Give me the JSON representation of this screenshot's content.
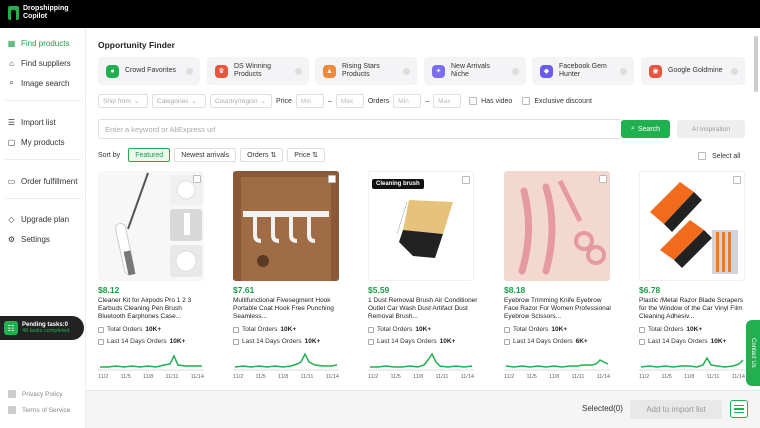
{
  "app": {
    "name": "Dropshipping Copilot"
  },
  "sidebar": {
    "items": [
      {
        "label": "Find products",
        "icon": "grid-icon"
      },
      {
        "label": "Find suppliers",
        "icon": "store-icon"
      },
      {
        "label": "Image search",
        "icon": "search-icon"
      },
      {
        "label": "Import list",
        "icon": "list-icon"
      },
      {
        "label": "My products",
        "icon": "box-icon"
      },
      {
        "label": "Order fulfillment",
        "icon": "truck-icon"
      },
      {
        "label": "Upgrade plan",
        "icon": "diamond-icon"
      },
      {
        "label": "Settings",
        "icon": "gear-icon"
      }
    ],
    "pending": {
      "title": "Pending tasks:0",
      "sub": "48 tasks completed"
    },
    "footer": [
      {
        "label": "Privacy Policy"
      },
      {
        "label": "Terms of Service"
      }
    ]
  },
  "main": {
    "title": "Opportunity Finder",
    "opportunities": [
      {
        "label": "Crowd Favorites",
        "color": "#21b04f"
      },
      {
        "label": "DS Winning Products",
        "color": "#e8553e"
      },
      {
        "label": "Rising Stars Products",
        "color": "#f08a3a"
      },
      {
        "label": "New Arrivals Niche",
        "color": "#7b6cf0"
      },
      {
        "label": "Facebook Gem Hunter",
        "color": "#6a5cf0"
      },
      {
        "label": "Google Goldmine",
        "color": "#e8553e"
      }
    ],
    "filters": {
      "ship_from": "Ship from",
      "categories": "Categories",
      "country": "Country/region",
      "price_label": "Price",
      "min": "Min",
      "max": "Max",
      "dash": "–",
      "orders_label": "Orders",
      "has_video": "Has video",
      "exclusive": "Exclusive discount"
    },
    "search": {
      "placeholder": "Enter a keyword or AliExpress url",
      "button": "Search",
      "ai": "AI Inspiration"
    },
    "sort": {
      "label": "Sort by",
      "options": [
        "Featured",
        "Newest arrivals",
        "Orders ⇅",
        "Price ⇅"
      ],
      "select_all": "Select all"
    },
    "products": [
      {
        "price": "$8.12",
        "title": "Cleaner Kit for Airpods Pro 1 2 3 Earbuds Cleaning Pen Brush Bluetooth Earphones Case...",
        "total_label": "Total Orders",
        "total": "10K+",
        "recent_label": "Last 14 Days Orders",
        "recent": "10K+"
      },
      {
        "price": "$7.61",
        "title": "Multifunctional Fivesegment Hook Portable Coat Hook Free Punching Seamless...",
        "total_label": "Total Orders",
        "total": "10K+",
        "recent_label": "Last 14 Days Orders",
        "recent": "10K+"
      },
      {
        "price": "$5.59",
        "title": "1 Dust Removal Brush Air Conditioner Outlet Car Wash Dust Artifact Dust Removal Brush...",
        "total_label": "Total Orders",
        "total": "10K+",
        "recent_label": "Last 14 Days Orders",
        "recent": "10K+",
        "badge": "Cleaning brush"
      },
      {
        "price": "$8.18",
        "title": "Eyebrow Trimming Knife Eyebrow Face Razor For Women Professional Eyebrow Scissors...",
        "total_label": "Total Orders",
        "total": "10K+",
        "recent_label": "Last 14 Days Orders",
        "recent": "6K+"
      },
      {
        "price": "$6.78",
        "title": "Plastic /Metal Razor Blade Scrapers for the Window of the Car Vinyl Film Cleaning Adhesiv...",
        "total_label": "Total Orders",
        "total": "10K+",
        "recent_label": "Last 14 Days Orders",
        "recent": "10K+"
      }
    ],
    "ticks": [
      "11/2",
      "11/5",
      "11/8",
      "11/11",
      "11/14"
    ]
  },
  "bottom": {
    "selected": "Selected(0)",
    "add": "Add to import list"
  },
  "contact": "Contact Us"
}
